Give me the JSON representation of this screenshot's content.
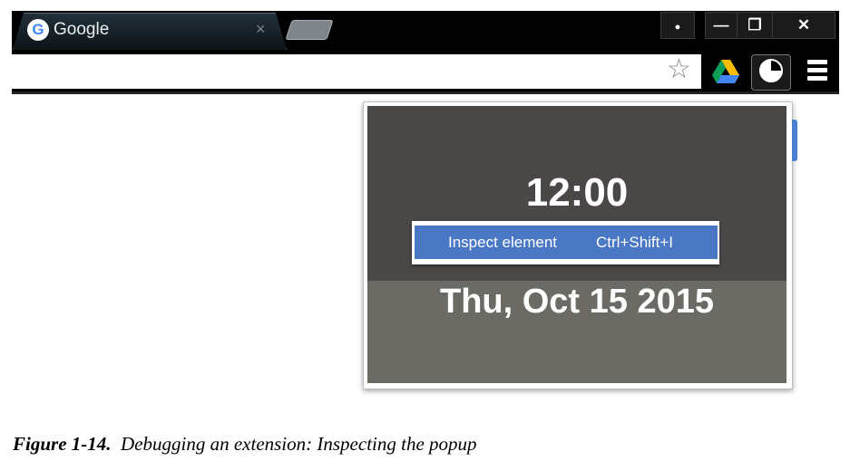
{
  "browser": {
    "tab_title": "Google",
    "tab_logo": "G",
    "tab_close": "×",
    "window_buttons": [
      {
        "name": "profile-button",
        "symbol": "●"
      },
      {
        "name": "minimize-button",
        "symbol": "—"
      },
      {
        "name": "restore-button",
        "symbol": "❐"
      },
      {
        "name": "close-window-button",
        "symbol": "✕"
      }
    ],
    "bookmark_star": "☆"
  },
  "popup": {
    "time": "12:00",
    "date": "Thu, Oct 15 2015"
  },
  "context_menu": {
    "label": "Inspect element",
    "shortcut": "Ctrl+Shift+I"
  },
  "caption": {
    "figure": "Figure 1-14.",
    "text": "Debugging an extension: Inspecting the popup"
  },
  "colors": {
    "accent": "#4a78c4",
    "popup_top": "#4a4746",
    "popup_bottom": "#6b6a65"
  }
}
